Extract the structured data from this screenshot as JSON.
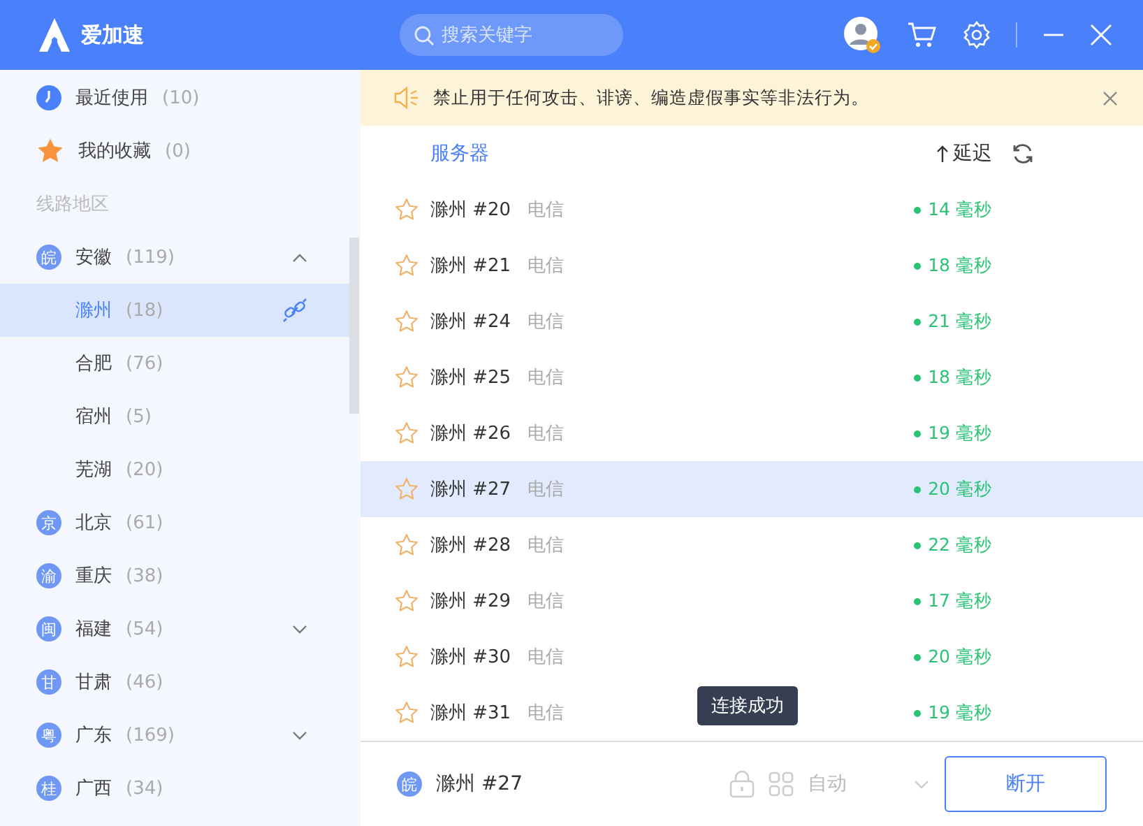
{
  "title_bar": {
    "app_name": "爱加速",
    "search": {
      "placeholder": "搜索关键字"
    }
  },
  "sidebar": {
    "items": [
      {
        "kind": "recent",
        "label": "最近使用",
        "count": "(10)"
      },
      {
        "kind": "favorites",
        "label": "我的收藏",
        "count": "(0)"
      },
      {
        "kind": "section",
        "label": "线路地区"
      },
      {
        "kind": "region",
        "badge": "皖",
        "label": "安徽",
        "count": "(119)",
        "expanded": true,
        "children": [
          {
            "label": "滁州",
            "count": "(18)",
            "selected": true
          },
          {
            "label": "合肥",
            "count": "(76)",
            "selected": false
          },
          {
            "label": "宿州",
            "count": "(5)",
            "selected": false
          },
          {
            "label": "芜湖",
            "count": "(20)",
            "selected": false
          }
        ]
      },
      {
        "kind": "region",
        "badge": "京",
        "label": "北京",
        "count": "(61)"
      },
      {
        "kind": "region",
        "badge": "渝",
        "label": "重庆",
        "count": "(38)"
      },
      {
        "kind": "region",
        "badge": "闽",
        "label": "福建",
        "count": "(54)",
        "expanded": false
      },
      {
        "kind": "region",
        "badge": "甘",
        "label": "甘肃",
        "count": "(46)"
      },
      {
        "kind": "region",
        "badge": "粤",
        "label": "广东",
        "count": "(169)",
        "expanded": false
      },
      {
        "kind": "region",
        "badge": "桂",
        "label": "广西",
        "count": "(34)"
      }
    ]
  },
  "notice": {
    "text": "禁止用于任何攻击、诽谤、编造虚假事实等非法行为。"
  },
  "server_list": {
    "columns": [
      "服务器",
      "延迟"
    ],
    "rows": [
      {
        "name": "滁州 #20",
        "isp": "电信",
        "latency": "14 毫秒",
        "selected": false
      },
      {
        "name": "滁州 #21",
        "isp": "电信",
        "latency": "18 毫秒",
        "selected": false
      },
      {
        "name": "滁州 #24",
        "isp": "电信",
        "latency": "21 毫秒",
        "selected": false
      },
      {
        "name": "滁州 #25",
        "isp": "电信",
        "latency": "18 毫秒",
        "selected": false
      },
      {
        "name": "滁州 #26",
        "isp": "电信",
        "latency": "19 毫秒",
        "selected": false
      },
      {
        "name": "滁州 #27",
        "isp": "电信",
        "latency": "20 毫秒",
        "selected": true
      },
      {
        "name": "滁州 #28",
        "isp": "电信",
        "latency": "22 毫秒",
        "selected": false
      },
      {
        "name": "滁州 #29",
        "isp": "电信",
        "latency": "17 毫秒",
        "selected": false
      },
      {
        "name": "滁州 #30",
        "isp": "电信",
        "latency": "20 毫秒",
        "selected": false
      },
      {
        "name": "滁州 #31",
        "isp": "电信",
        "latency": "19 毫秒",
        "selected": false
      }
    ]
  },
  "tooltip": "连接成功",
  "footer": {
    "badge": "皖",
    "server": "滁州 #27",
    "mode": "自动",
    "disconnect_button": "断开"
  }
}
